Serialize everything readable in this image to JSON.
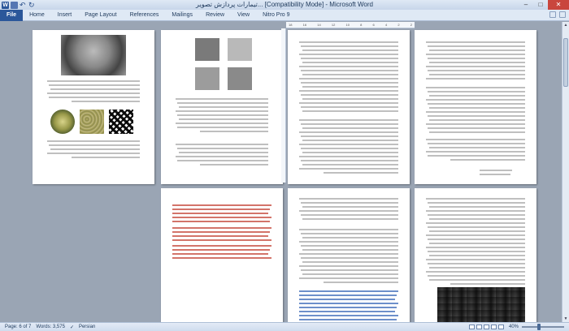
{
  "window": {
    "title": "تیمارات پردازش تصویر... [Compatibility Mode] - Microsoft Word",
    "app_icon_letter": "W"
  },
  "ribbon": {
    "file_tab": "File",
    "tabs": [
      "Home",
      "Insert",
      "Page Layout",
      "References",
      "Mailings",
      "Review",
      "View",
      "Nitro Pro 9"
    ]
  },
  "ruler": {
    "ticks": [
      "18",
      "16",
      "14",
      "12",
      "10",
      "8",
      "6",
      "4",
      "2",
      "2"
    ]
  },
  "status": {
    "page": "Page: 6 of 7",
    "words": "Words: 3,575",
    "language": "Persian",
    "zoom": "40%"
  },
  "zoom_level": 0.4,
  "colors": {
    "file_tab": "#2b579a",
    "doc_background": "#9aa5b4",
    "close_button": "#c9463d"
  }
}
